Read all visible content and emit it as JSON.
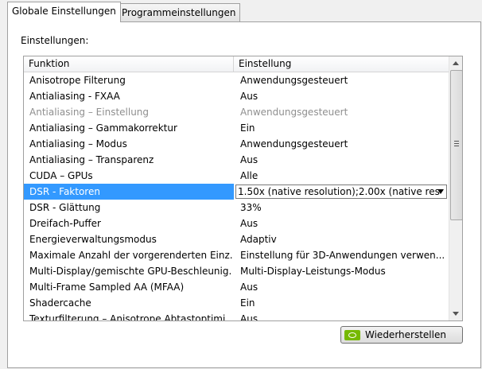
{
  "tabs": [
    {
      "label": "Globale Einstellungen",
      "active": true
    },
    {
      "label": "Programmeinstellungen",
      "active": false
    }
  ],
  "section_label": "Einstellungen:",
  "columns": {
    "funktion": "Funktion",
    "einstellung": "Einstellung"
  },
  "rows": [
    {
      "function": "Anisotrope Filterung",
      "setting": "Anwendungsgesteuert"
    },
    {
      "function": "Antialiasing - FXAA",
      "setting": "Aus"
    },
    {
      "function": "Antialiasing – Einstellung",
      "setting": "Anwendungsgesteuert",
      "disabled": true
    },
    {
      "function": "Antialiasing – Gammakorrektur",
      "setting": "Ein"
    },
    {
      "function": "Antialiasing – Modus",
      "setting": "Anwendungsgesteuert"
    },
    {
      "function": "Antialiasing – Transparenz",
      "setting": "Aus"
    },
    {
      "function": "CUDA – GPUs",
      "setting": "Alle"
    },
    {
      "function": "DSR - Faktoren",
      "setting": "1.50x (native resolution);2.00x (native res",
      "selected": true
    },
    {
      "function": "DSR - Glättung",
      "setting": "33%"
    },
    {
      "function": "Dreifach-Puffer",
      "setting": "Aus"
    },
    {
      "function": "Energieverwaltungsmodus",
      "setting": "Adaptiv"
    },
    {
      "function": "Maximale Anzahl der vorgerenderten Einz...",
      "setting": "Einstellung für 3D-Anwendungen verwen..."
    },
    {
      "function": "Multi-Display/gemischte GPU-Beschleunig...",
      "setting": "Multi-Display-Leistungs-Modus"
    },
    {
      "function": "Multi-Frame Sampled AA (MFAA)",
      "setting": "Aus"
    },
    {
      "function": "Shadercache",
      "setting": "Ein"
    },
    {
      "function": "Texturfilterung – Anisotrope Abtastoptimi",
      "setting": "Aus"
    }
  ],
  "restore_button": {
    "label": "Wiederherstellen",
    "icon": "nvidia-logo-icon"
  },
  "colors": {
    "selection": "#3399ff",
    "nvidia_green": "#76b900",
    "disabled_text": "#8f8f8f"
  }
}
